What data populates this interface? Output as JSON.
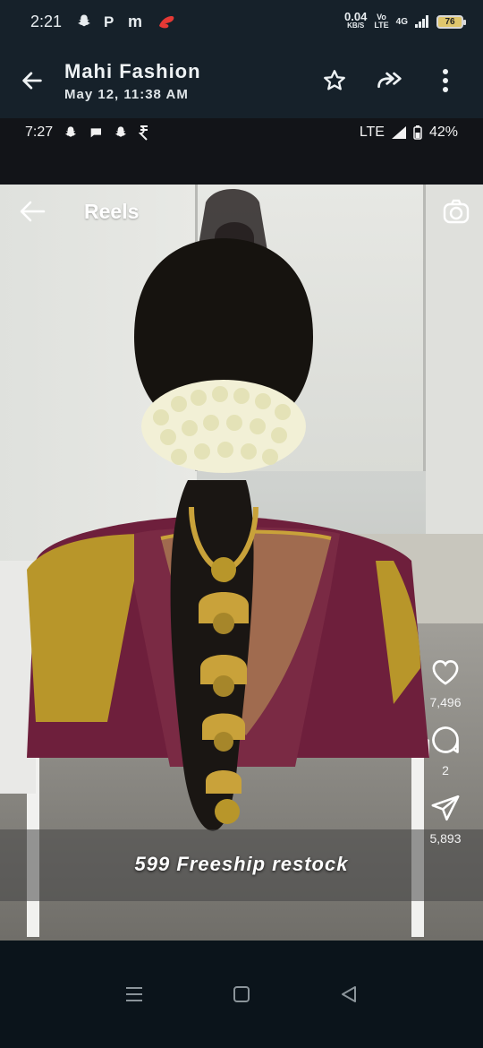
{
  "status_bar": {
    "time": "2:21",
    "net_speed": "0.04",
    "net_unit": "KB/S",
    "volte_top": "Vo",
    "volte_bottom": "LTE",
    "network": "4G",
    "battery": "76"
  },
  "header": {
    "title": "Mahi Fashion",
    "subtitle": "May 12, 11:38 AM"
  },
  "media": {
    "inner_status": {
      "time": "7:27",
      "network": "LTE",
      "battery": "42%"
    },
    "reels_title": "Reels",
    "caption": "599 Freeship restock",
    "likes": "7,496",
    "comments": "2",
    "shares": "5,893"
  },
  "colors": {
    "header_bg": "#16212a",
    "blouse": "#6e1f3c",
    "saree_gold": "#b8962a",
    "jasmine": "#f2f0d6"
  }
}
